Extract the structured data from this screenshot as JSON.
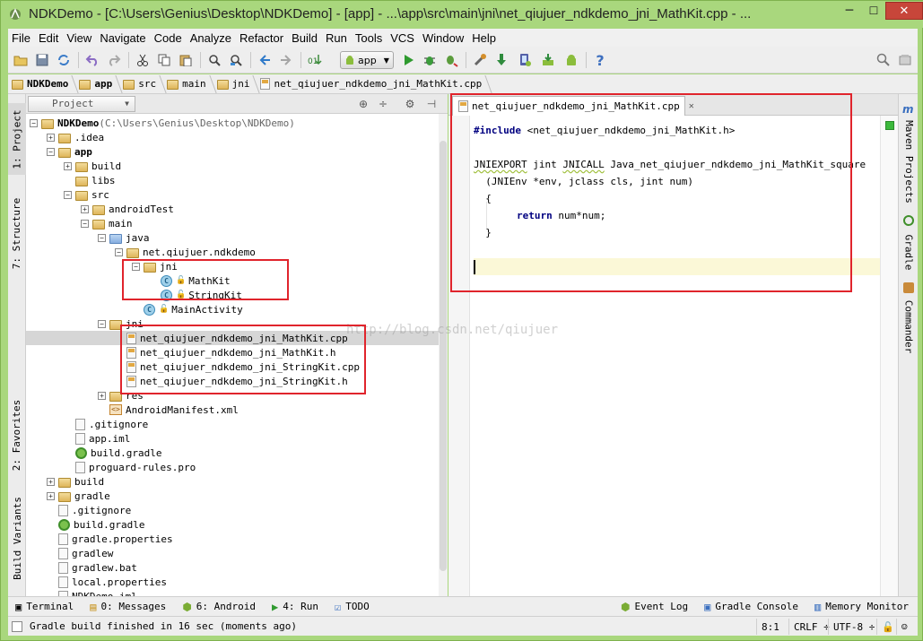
{
  "window": {
    "title": "NDKDemo - [C:\\Users\\Genius\\Desktop\\NDKDemo] - [app] - ...\\app\\src\\main\\jni\\net_qiujuer_ndkdemo_jni_MathKit.cpp - ...",
    "controls": {
      "minimize": "─",
      "maximize": "☐",
      "close": "✕"
    }
  },
  "menu": [
    "File",
    "Edit",
    "View",
    "Navigate",
    "Code",
    "Analyze",
    "Refactor",
    "Build",
    "Run",
    "Tools",
    "VCS",
    "Window",
    "Help"
  ],
  "toolbar": {
    "run_config": "app",
    "icons": [
      "open-icon",
      "save-icon",
      "sync-icon",
      "undo-icon",
      "redo-icon",
      "cut-icon",
      "copy-icon",
      "paste-icon",
      "find-icon",
      "replace-icon",
      "back-icon",
      "forward-icon",
      "make-icon",
      "run-icon",
      "debug-icon",
      "attach-icon",
      "project-structure-icon",
      "sdk-sync-icon",
      "avd-manager-icon",
      "sdk-manager-icon",
      "android-device-icon",
      "help-icon",
      "search-everywhere-icon"
    ]
  },
  "breadcrumb": [
    "NDKDemo",
    "app",
    "src",
    "main",
    "jni",
    "net_qiujuer_ndkdemo_jni_MathKit.cpp"
  ],
  "left_strip": {
    "project": "1: Project",
    "structure": "7: Structure",
    "favorites": "2: Favorites",
    "build_variants": "Build Variants"
  },
  "right_strip": {
    "maven": "Maven Projects",
    "gradle": "Gradle",
    "commander": "Commander"
  },
  "project_panel": {
    "view_label": "Project",
    "tree": [
      {
        "label": "NDKDemo",
        "suffix": " (C:\\Users\\Genius\\Desktop\\NDKDemo)",
        "depth": 0,
        "toggle": "−",
        "icon": "folder"
      },
      {
        "label": ".idea",
        "depth": 1,
        "toggle": "+",
        "icon": "folder"
      },
      {
        "label": "app",
        "depth": 1,
        "toggle": "−",
        "icon": "folder"
      },
      {
        "label": "build",
        "depth": 2,
        "toggle": "+",
        "icon": "folder"
      },
      {
        "label": "libs",
        "depth": 2,
        "toggle": "",
        "icon": "folder"
      },
      {
        "label": "src",
        "depth": 2,
        "toggle": "−",
        "icon": "folder"
      },
      {
        "label": "androidTest",
        "depth": 3,
        "toggle": "+",
        "icon": "folder"
      },
      {
        "label": "main",
        "depth": 3,
        "toggle": "−",
        "icon": "folder"
      },
      {
        "label": "java",
        "depth": 4,
        "toggle": "−",
        "icon": "folder-blue"
      },
      {
        "label": "net.qiujuer.ndkdemo",
        "depth": 5,
        "toggle": "−",
        "icon": "folder"
      },
      {
        "label": "jni",
        "depth": 6,
        "toggle": "−",
        "icon": "folder"
      },
      {
        "label": "MathKit",
        "depth": 7,
        "toggle": "",
        "icon": "class"
      },
      {
        "label": "StringKit",
        "depth": 7,
        "toggle": "",
        "icon": "class"
      },
      {
        "label": "MainActivity",
        "depth": 6,
        "toggle": "",
        "icon": "class"
      },
      {
        "label": "jni",
        "depth": 4,
        "toggle": "−",
        "icon": "folder"
      },
      {
        "label": "net_qiujuer_ndkdemo_jni_MathKit.cpp",
        "depth": 5,
        "toggle": "",
        "icon": "cpp",
        "selected": true
      },
      {
        "label": "net_qiujuer_ndkdemo_jni_MathKit.h",
        "depth": 5,
        "toggle": "",
        "icon": "h"
      },
      {
        "label": "net_qiujuer_ndkdemo_jni_StringKit.cpp",
        "depth": 5,
        "toggle": "",
        "icon": "cpp"
      },
      {
        "label": "net_qiujuer_ndkdemo_jni_StringKit.h",
        "depth": 5,
        "toggle": "",
        "icon": "h"
      },
      {
        "label": "res",
        "depth": 4,
        "toggle": "+",
        "icon": "folder"
      },
      {
        "label": "AndroidManifest.xml",
        "depth": 4,
        "toggle": "",
        "icon": "xml"
      },
      {
        "label": ".gitignore",
        "depth": 2,
        "toggle": "",
        "icon": "file"
      },
      {
        "label": "app.iml",
        "depth": 2,
        "toggle": "",
        "icon": "file"
      },
      {
        "label": "build.gradle",
        "depth": 2,
        "toggle": "",
        "icon": "gradle"
      },
      {
        "label": "proguard-rules.pro",
        "depth": 2,
        "toggle": "",
        "icon": "file"
      },
      {
        "label": "build",
        "depth": 1,
        "toggle": "+",
        "icon": "folder"
      },
      {
        "label": "gradle",
        "depth": 1,
        "toggle": "+",
        "icon": "folder"
      },
      {
        "label": ".gitignore",
        "depth": 1,
        "toggle": "",
        "icon": "file"
      },
      {
        "label": "build.gradle",
        "depth": 1,
        "toggle": "",
        "icon": "gradle"
      },
      {
        "label": "gradle.properties",
        "depth": 1,
        "toggle": "",
        "icon": "file"
      },
      {
        "label": "gradlew",
        "depth": 1,
        "toggle": "",
        "icon": "file"
      },
      {
        "label": "gradlew.bat",
        "depth": 1,
        "toggle": "",
        "icon": "file"
      },
      {
        "label": "local.properties",
        "depth": 1,
        "toggle": "",
        "icon": "file"
      },
      {
        "label": "NDKDemo.iml",
        "depth": 1,
        "toggle": "",
        "icon": "file"
      }
    ]
  },
  "editor": {
    "tab": "net_qiujuer_ndkdemo_jni_MathKit.cpp",
    "lines": {
      "l1_kw": "#include",
      "l1_rest": " <net_qiujuer_ndkdemo_jni_MathKit.h>",
      "l3_a": "JNIEXPORT",
      "l3_b": " jint ",
      "l3_c": "JNICALL",
      "l3_d": " Java_net_qiujuer_ndkdemo_jni_MathKit_square",
      "l4": "  (JNIEnv *env, jclass cls, jint num)",
      "l5": "  {",
      "l6_kw": "return",
      "l6_rest": " num*num;",
      "l7": "  }"
    }
  },
  "watermark": "http://blog.csdn.net/qiujuer",
  "bottom_tabs": [
    {
      "label": "Terminal",
      "icon": "terminal-icon"
    },
    {
      "label": "0: Messages",
      "icon": "messages-icon"
    },
    {
      "label": "6: Android",
      "icon": "android-icon"
    },
    {
      "label": "4: Run",
      "icon": "run-icon"
    },
    {
      "label": "TODO",
      "icon": "todo-icon"
    },
    {
      "label": "Event Log",
      "icon": "event-log-icon"
    },
    {
      "label": "Gradle Console",
      "icon": "gradle-console-icon"
    },
    {
      "label": "Memory Monitor",
      "icon": "memory-monitor-icon"
    }
  ],
  "status": {
    "message": "Gradle build finished in 16 sec (moments ago)",
    "position": "8:1",
    "line_sep": "CRLF ÷",
    "encoding": "UTF-8 ÷"
  },
  "colors": {
    "annotation": "#e0242c",
    "window_frame": "#a9d77d",
    "keyword": "#000080"
  }
}
